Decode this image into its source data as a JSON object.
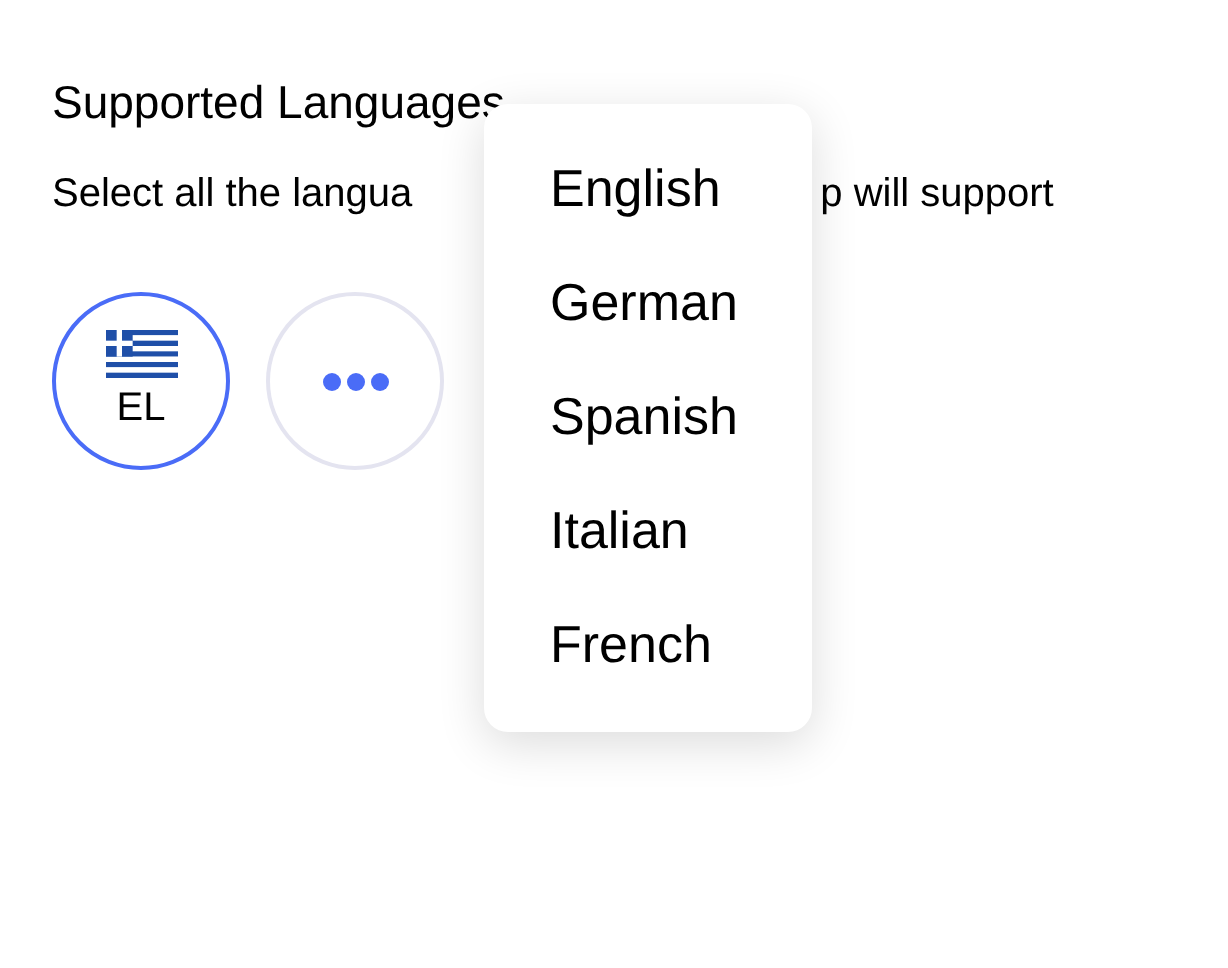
{
  "title": "Supported Languages",
  "subtitle_left": "Select all the langua",
  "subtitle_right": "p will support",
  "chips": [
    {
      "kind": "flag",
      "label": "EL",
      "selected": true
    },
    {
      "kind": "more",
      "selected": false
    }
  ],
  "menu": [
    "English",
    "German",
    "Spanish",
    "Italian",
    "French"
  ]
}
